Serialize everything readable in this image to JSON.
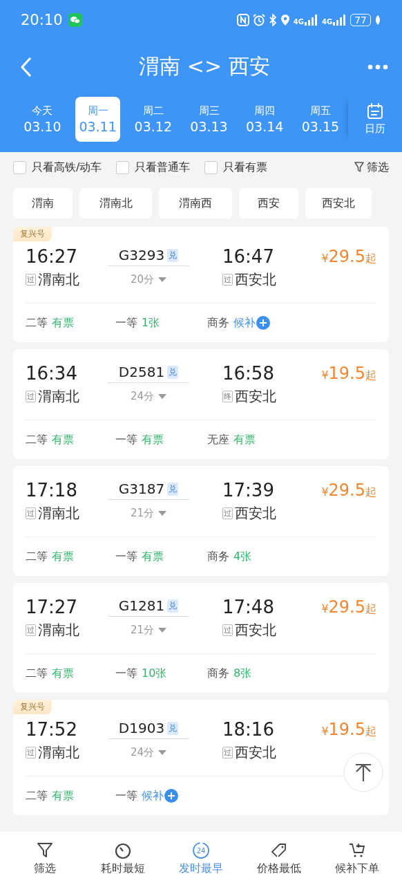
{
  "status_bar": {
    "time": "20:10",
    "signals": [
      {
        "label": "4G"
      },
      {
        "label": "4G"
      }
    ],
    "battery": "77"
  },
  "header": {
    "title": "渭南 <> 西安"
  },
  "dates": [
    {
      "weekday": "今天",
      "date": "03.10",
      "selected": false
    },
    {
      "weekday": "周一",
      "date": "03.11",
      "selected": true
    },
    {
      "weekday": "周二",
      "date": "03.12",
      "selected": false
    },
    {
      "weekday": "周三",
      "date": "03.13",
      "selected": false
    },
    {
      "weekday": "周四",
      "date": "03.14",
      "selected": false
    },
    {
      "weekday": "周五",
      "date": "03.15",
      "selected": false
    }
  ],
  "calendar": {
    "label": "日历"
  },
  "filters": [
    {
      "label": "只看高铁/动车",
      "checked": false
    },
    {
      "label": "只看普通车",
      "checked": false
    },
    {
      "label": "只看有票",
      "checked": false
    }
  ],
  "filter_button": {
    "label": "筛选"
  },
  "stations": [
    "渭南",
    "渭南北",
    "渭南西",
    "西安",
    "西安北"
  ],
  "trains": [
    {
      "badge": "复兴号",
      "depart": "16:27",
      "train_no": "G3293",
      "tag": "兑",
      "arrive": "16:47",
      "from_mark": "过",
      "from": "渭南北",
      "duration": "20分",
      "to_mark": "过",
      "to": "西安北",
      "price": "29.5",
      "currency": "¥",
      "suffix": "起",
      "seats": [
        {
          "class": "二等",
          "status": "有票",
          "kind": "available"
        },
        {
          "class": "一等",
          "status": "1张",
          "kind": "available"
        },
        {
          "class": "商务",
          "status": "候补",
          "kind": "waitlist"
        }
      ]
    },
    {
      "depart": "16:34",
      "train_no": "D2581",
      "tag": "兑",
      "arrive": "16:58",
      "from_mark": "过",
      "from": "渭南北",
      "duration": "24分",
      "to_mark": "终",
      "to": "西安北",
      "price": "19.5",
      "currency": "¥",
      "suffix": "起",
      "seats": [
        {
          "class": "二等",
          "status": "有票",
          "kind": "available"
        },
        {
          "class": "一等",
          "status": "有票",
          "kind": "available"
        },
        {
          "class": "无座",
          "status": "有票",
          "kind": "available"
        }
      ]
    },
    {
      "depart": "17:18",
      "train_no": "G3187",
      "tag": "兑",
      "arrive": "17:39",
      "from_mark": "过",
      "from": "渭南北",
      "duration": "21分",
      "to_mark": "过",
      "to": "西安北",
      "price": "29.5",
      "currency": "¥",
      "suffix": "起",
      "seats": [
        {
          "class": "二等",
          "status": "有票",
          "kind": "available"
        },
        {
          "class": "一等",
          "status": "有票",
          "kind": "available"
        },
        {
          "class": "商务",
          "status": "4张",
          "kind": "available"
        }
      ]
    },
    {
      "depart": "17:27",
      "train_no": "G1281",
      "tag": "兑",
      "arrive": "17:48",
      "from_mark": "过",
      "from": "渭南北",
      "duration": "21分",
      "to_mark": "过",
      "to": "西安北",
      "price": "29.5",
      "currency": "¥",
      "suffix": "起",
      "seats": [
        {
          "class": "二等",
          "status": "有票",
          "kind": "available"
        },
        {
          "class": "一等",
          "status": "10张",
          "kind": "available"
        },
        {
          "class": "商务",
          "status": "8张",
          "kind": "available"
        }
      ]
    },
    {
      "badge": "复兴号",
      "depart": "17:52",
      "train_no": "D1903",
      "tag": "兑",
      "arrive": "18:16",
      "from_mark": "过",
      "from": "渭南北",
      "duration": "24分",
      "to_mark": "过",
      "to": "西安北",
      "price": "19.5",
      "currency": "¥",
      "suffix": "起",
      "seats": [
        {
          "class": "二等",
          "status": "有票",
          "kind": "available"
        },
        {
          "class": "一等",
          "status": "候补",
          "kind": "waitlist"
        }
      ]
    }
  ],
  "bottom_nav": [
    {
      "label": "筛选",
      "kind": "filter",
      "selected": false
    },
    {
      "label": "耗时最短",
      "kind": "timer",
      "selected": false
    },
    {
      "label": "发时最早",
      "kind": "clock",
      "icon_text": "24",
      "selected": true
    },
    {
      "label": "价格最低",
      "kind": "tag",
      "selected": false
    },
    {
      "label": "候补下单",
      "kind": "cart",
      "selected": false
    }
  ]
}
